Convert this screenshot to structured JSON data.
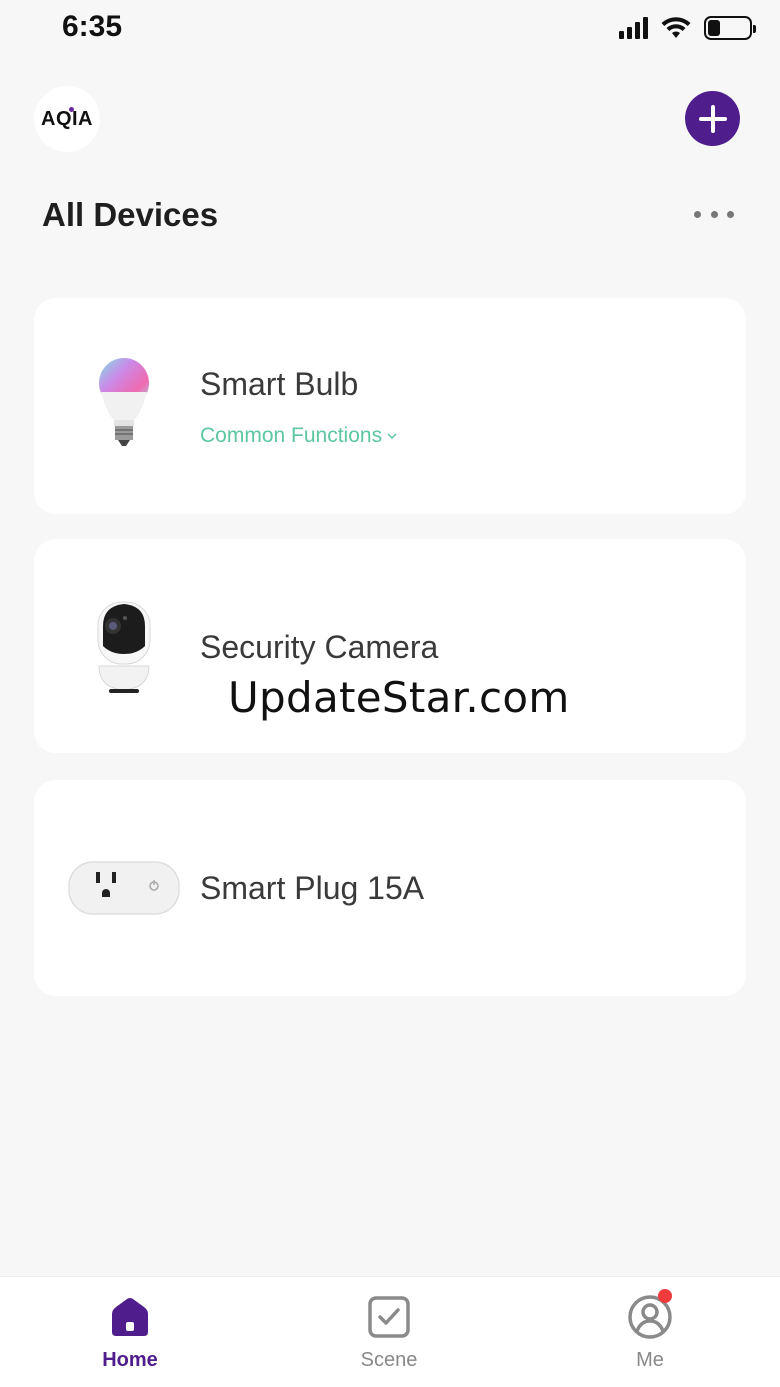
{
  "status_bar": {
    "time": "6:35",
    "icons": [
      "signal-icon",
      "wifi-icon",
      "battery-icon"
    ],
    "battery_level": 0.3
  },
  "header": {
    "logo_text": "AQIA",
    "add_icon": "plus-icon",
    "title": "All Devices",
    "more_icon": "more-horizontal-icon"
  },
  "devices": [
    {
      "name": "Smart Bulb",
      "icon": "smart-bulb-icon",
      "action_label": "Common Functions",
      "action_icon": "chevron-down-icon"
    },
    {
      "name": "Security Camera",
      "icon": "security-camera-icon"
    },
    {
      "name": "Smart Plug 15A",
      "icon": "smart-plug-icon"
    }
  ],
  "watermark": "UpdateStar.com",
  "tabs": [
    {
      "label": "Home",
      "icon": "home-icon",
      "active": true
    },
    {
      "label": "Scene",
      "icon": "scene-checkbox-icon",
      "active": false
    },
    {
      "label": "Me",
      "icon": "profile-icon",
      "active": false,
      "badge": true
    }
  ],
  "colors": {
    "accent": "#4f1d8c",
    "link": "#5cc7a0",
    "background": "#f7f7f7",
    "card": "#ffffff",
    "badge": "#ef3b3b"
  }
}
